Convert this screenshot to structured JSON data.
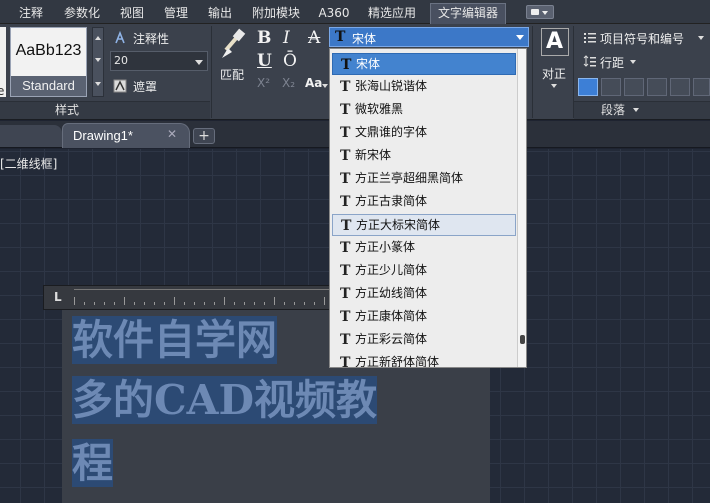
{
  "menu": {
    "tabs": [
      {
        "label": "注释",
        "active": false
      },
      {
        "label": "参数化",
        "active": false
      },
      {
        "label": "视图",
        "active": false
      },
      {
        "label": "管理",
        "active": false
      },
      {
        "label": "输出",
        "active": false
      },
      {
        "label": "附加模块",
        "active": false
      },
      {
        "label": "A360",
        "active": false
      },
      {
        "label": "精选应用",
        "active": false
      },
      {
        "label": "文字编辑器",
        "active": true
      }
    ]
  },
  "ribbon": {
    "style_panel": {
      "left_partial_label": "e",
      "preview_text": "AaBb123",
      "style_name": "Standard",
      "title": "样式",
      "annotative_label": "注释性",
      "text_height": "20",
      "mask_label": "遮罩"
    },
    "format_panel": {
      "match_label": "匹配",
      "bold": "B",
      "italic": "I",
      "strike": "A",
      "underline": "U",
      "overline": "Ō",
      "superscript": "X²",
      "subscript": "X₂",
      "case": "Aa"
    },
    "font_combo": {
      "value": "宋体"
    },
    "paragraph_panel": {
      "align_label": "对正",
      "bullets_label": "项目符号和编号",
      "line_spacing_label": "行距",
      "title": "段落"
    }
  },
  "doc_tabs": {
    "active_label": "Drawing1*",
    "add_label": "+"
  },
  "viewport": {
    "view_label": "[二维线框]",
    "ruler_label": "L",
    "mtext_lines": [
      "软件自学网",
      "多的CAD视频教",
      "程"
    ]
  },
  "font_dropdown": {
    "items": [
      {
        "name": "宋体",
        "state": "selected"
      },
      {
        "name": "张海山锐谐体",
        "state": ""
      },
      {
        "name": "微软雅黑",
        "state": ""
      },
      {
        "name": "文鼎谁的字体",
        "state": ""
      },
      {
        "name": "新宋体",
        "state": ""
      },
      {
        "name": "方正兰亭超细黑简体",
        "state": ""
      },
      {
        "name": "方正古隶简体",
        "state": ""
      },
      {
        "name": "方正大标宋简体",
        "state": "hover"
      },
      {
        "name": "方正小篆体",
        "state": ""
      },
      {
        "name": "方正少儿简体",
        "state": ""
      },
      {
        "name": "方正幼线简体",
        "state": ""
      },
      {
        "name": "方正康体简体",
        "state": ""
      },
      {
        "name": "方正彩云简体",
        "state": ""
      },
      {
        "name": "方正新舒体简体",
        "state": ""
      }
    ]
  },
  "icons": {
    "font_type_icon": "T",
    "close_icon": "✕"
  }
}
